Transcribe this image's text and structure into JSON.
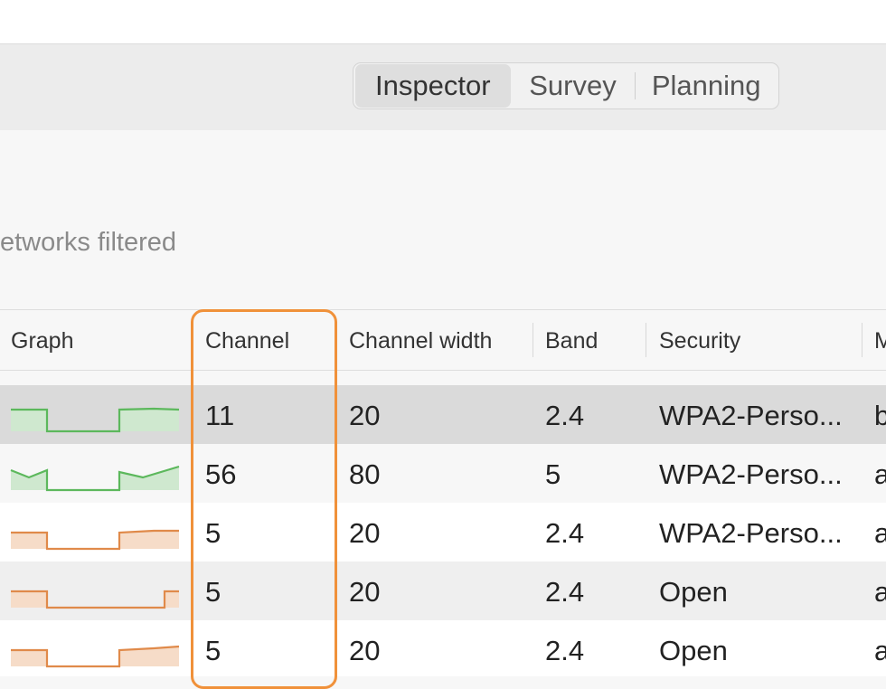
{
  "tabs": [
    {
      "label": "Inspector",
      "active": true
    },
    {
      "label": "Survey",
      "active": false
    },
    {
      "label": "Planning",
      "active": false
    }
  ],
  "filter_text": "etworks filtered",
  "columns": {
    "graph": "Graph",
    "channel": "Channel",
    "channel_width": "Channel width",
    "band": "Band",
    "security": "Security",
    "more": "M"
  },
  "rows": [
    {
      "channel": "11",
      "channel_width": "20",
      "band": "2.4",
      "security": "WPA2-Perso...",
      "more": "b",
      "graph_color": "green"
    },
    {
      "channel": "56",
      "channel_width": "80",
      "band": "5",
      "security": "WPA2-Perso...",
      "more": "a",
      "graph_color": "green"
    },
    {
      "channel": "5",
      "channel_width": "20",
      "band": "2.4",
      "security": "WPA2-Perso...",
      "more": "a",
      "graph_color": "orange"
    },
    {
      "channel": "5",
      "channel_width": "20",
      "band": "2.4",
      "security": "Open",
      "more": "a",
      "graph_color": "orange"
    },
    {
      "channel": "5",
      "channel_width": "20",
      "band": "2.4",
      "security": "Open",
      "more": "a",
      "graph_color": "orange"
    }
  ],
  "colors": {
    "highlight": "#f0913a",
    "graph_green_stroke": "#5cb85c",
    "graph_green_fill": "#cfe8cf",
    "graph_orange_stroke": "#e08a4a",
    "graph_orange_fill": "#f6dcc8"
  }
}
